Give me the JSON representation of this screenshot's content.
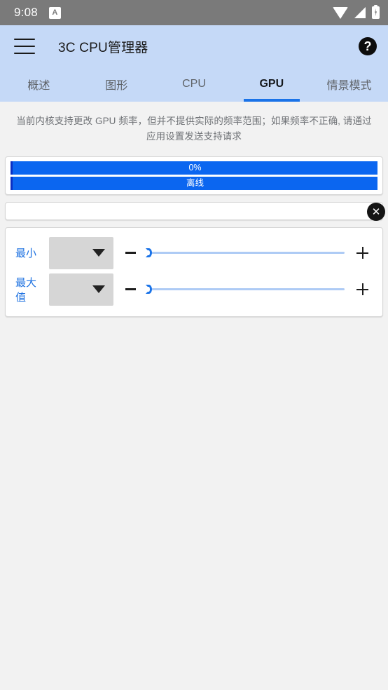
{
  "status_bar": {
    "time": "9:08",
    "app_badge": "A",
    "icons": [
      "wifi-icon",
      "signal-icon",
      "battery-charging-icon"
    ]
  },
  "app_bar": {
    "menu_icon": "hamburger-menu-icon",
    "title": "3C CPU管理器",
    "help_icon": "help-circle-icon"
  },
  "tabs": [
    {
      "label": "概述",
      "active": false
    },
    {
      "label": "图形",
      "active": false
    },
    {
      "label": "CPU",
      "active": false
    },
    {
      "label": "GPU",
      "active": true
    },
    {
      "label": "情景模式",
      "active": false
    }
  ],
  "notice": {
    "text": "当前内核支持更改 GPU 频率，但并不提供实际的频率范围；如果频率不正确, 请通过应用设置发送支持请求",
    "close_label": "✕"
  },
  "bars": [
    {
      "label": "0%"
    },
    {
      "label": "离线"
    }
  ],
  "sliders": [
    {
      "label": "最小",
      "dropdown_value": "",
      "minus_label": "−",
      "plus_label": "+",
      "value_percent": 0
    },
    {
      "label": "最大值",
      "dropdown_value": "",
      "minus_label": "−",
      "plus_label": "+",
      "value_percent": 0
    }
  ],
  "colors": {
    "accent": "#1a73e8",
    "bar_blue": "#0b66f0",
    "app_bar": "#c5d9f7",
    "status_bar": "#7a7a7a",
    "background": "#f2f2f2"
  }
}
